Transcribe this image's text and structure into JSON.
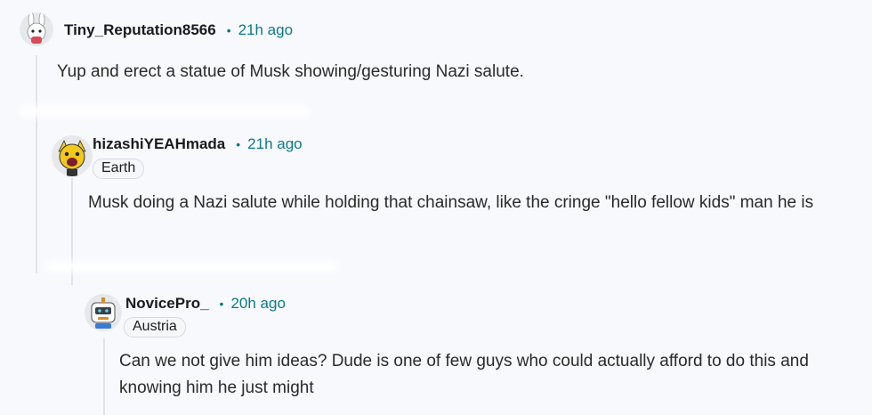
{
  "comments": [
    {
      "username": "Tiny_Reputation8566",
      "time": "21h ago",
      "flair": "",
      "body": "Yup and erect a statue of Musk showing/gesturing Nazi salute.",
      "avatar_icon": "bunny-avatar-icon"
    },
    {
      "username": "hizashiYEAHmada",
      "time": "21h ago",
      "flair": "Earth",
      "body": "Musk doing a Nazi salute while holding that chainsaw, like the cringe \"hello fellow kids\" man he is",
      "avatar_icon": "yellow-character-avatar-icon"
    },
    {
      "username": "NovicePro_",
      "time": "20h ago",
      "flair": "Austria",
      "body": "Can we not give him ideas? Dude is one of few guys who could actually afford to do this and knowing him he just might",
      "avatar_icon": "robot-avatar-icon"
    }
  ],
  "separator": "•",
  "colors": {
    "background": "#f7f9fc",
    "time": "#0b7a8a",
    "thread_line": "#dfe4ea"
  }
}
